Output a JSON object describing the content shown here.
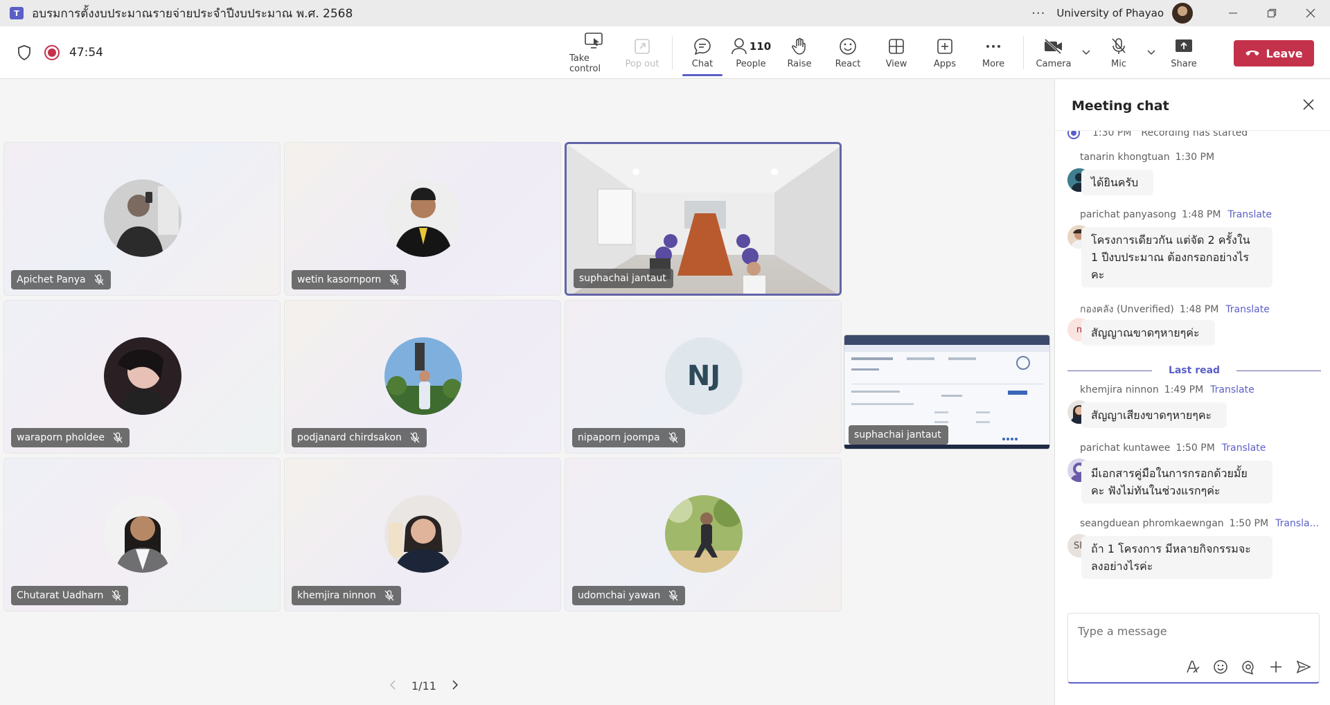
{
  "window": {
    "title": "อบรมการตั้งงบประมาณรายจ่ายประจำปีงบประมาณ พ.ศ. 2568",
    "org": "University of Phayao",
    "more_label": "···"
  },
  "toolbar": {
    "timer": "47:54",
    "take_control": "Take control",
    "pop_out": "Pop out",
    "chat": "Chat",
    "people": "People",
    "people_count": "110",
    "raise": "Raise",
    "react": "React",
    "view": "View",
    "apps": "Apps",
    "more": "More",
    "camera": "Camera",
    "mic": "Mic",
    "share": "Share",
    "leave": "Leave"
  },
  "participants": [
    {
      "name": "Apichet Panya",
      "muted": true
    },
    {
      "name": "wetin kasornporn",
      "muted": true
    },
    {
      "name": "suphachai jantaut",
      "speaking": true
    },
    {
      "name": "waraporn pholdee",
      "muted": true
    },
    {
      "name": "podjanard chirdsakon",
      "muted": true
    },
    {
      "name": "nipaporn joompa",
      "muted": true,
      "initials": "NJ"
    },
    {
      "name": "Chutarat Uadharn",
      "muted": true
    },
    {
      "name": "khemjira ninnon",
      "muted": true
    },
    {
      "name": "udomchai yawan",
      "muted": true
    }
  ],
  "screen_share": {
    "name": "suphachai jantaut"
  },
  "pager": {
    "label": "1/11"
  },
  "chat": {
    "title": "Meeting chat",
    "system": {
      "time": "1:30 PM",
      "text": "Recording has started"
    },
    "last_read": "Last read",
    "messages": [
      {
        "sender": "tanarin khongtuan",
        "time": "1:30 PM",
        "translate": "",
        "text": "ได้ยินครับ"
      },
      {
        "sender": "parichat panyasong",
        "time": "1:48 PM",
        "translate": "Translate",
        "lines": [
          "โครงการเดียวกัน แต่จัด 2 ครั้งใน",
          "1 ปีงบประมาณ ต้องกรอกอย่างไร",
          "คะ"
        ]
      },
      {
        "sender": "กองคลัง (Unverified)",
        "time": "1:48 PM",
        "translate": "Translate",
        "initial": "n",
        "text": "สัญญาณขาดๆหายๆค่ะ"
      },
      {
        "sender": "khemjira ninnon",
        "time": "1:49 PM",
        "translate": "Translate",
        "text": "สัญญาเสียงขาดๆหายๆคะ"
      },
      {
        "sender": "parichat kuntawee",
        "time": "1:50 PM",
        "translate": "Translate",
        "lines": [
          "มีเอกสารคู่มือในการกรอกด้วยมั้ย",
          "คะ ฟังไม่ทันในช่วงแรกๆค่ะ"
        ]
      },
      {
        "sender": "seangduean phromkaewngan",
        "time": "1:50 PM",
        "translate": "Transla...",
        "initial": "SP",
        "lines": [
          "ถ้า 1 โครงการ มีหลายกิจกรรมจะ",
          "ลงอย่างไรค่ะ"
        ]
      }
    ],
    "composer_placeholder": "Type a message"
  }
}
